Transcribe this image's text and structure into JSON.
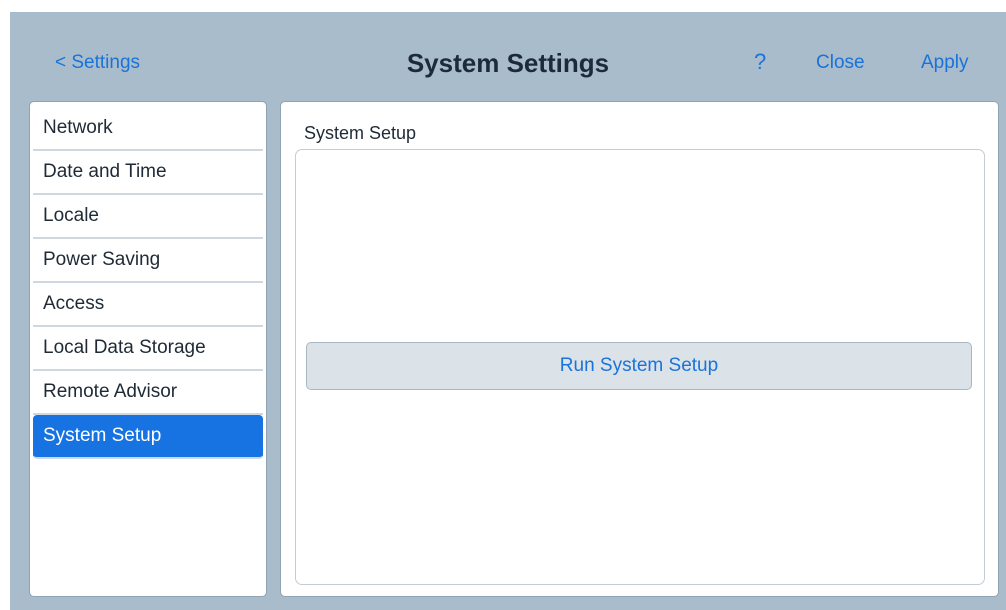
{
  "header": {
    "back_label": "< Settings",
    "title": "System Settings",
    "help_label": "?",
    "close_label": "Close",
    "apply_label": "Apply"
  },
  "sidebar": {
    "items": [
      {
        "label": "Network"
      },
      {
        "label": "Date and Time"
      },
      {
        "label": "Locale"
      },
      {
        "label": "Power Saving"
      },
      {
        "label": "Access"
      },
      {
        "label": "Local Data Storage"
      },
      {
        "label": "Remote Advisor"
      },
      {
        "label": "System Setup",
        "selected": true
      }
    ]
  },
  "main": {
    "section_title": "System Setup",
    "run_button_label": "Run System Setup"
  },
  "colors": {
    "accent": "#1773e2",
    "link": "#1a73d9",
    "window_bg": "#a9bccb",
    "button_bg": "#dbe2e8"
  }
}
